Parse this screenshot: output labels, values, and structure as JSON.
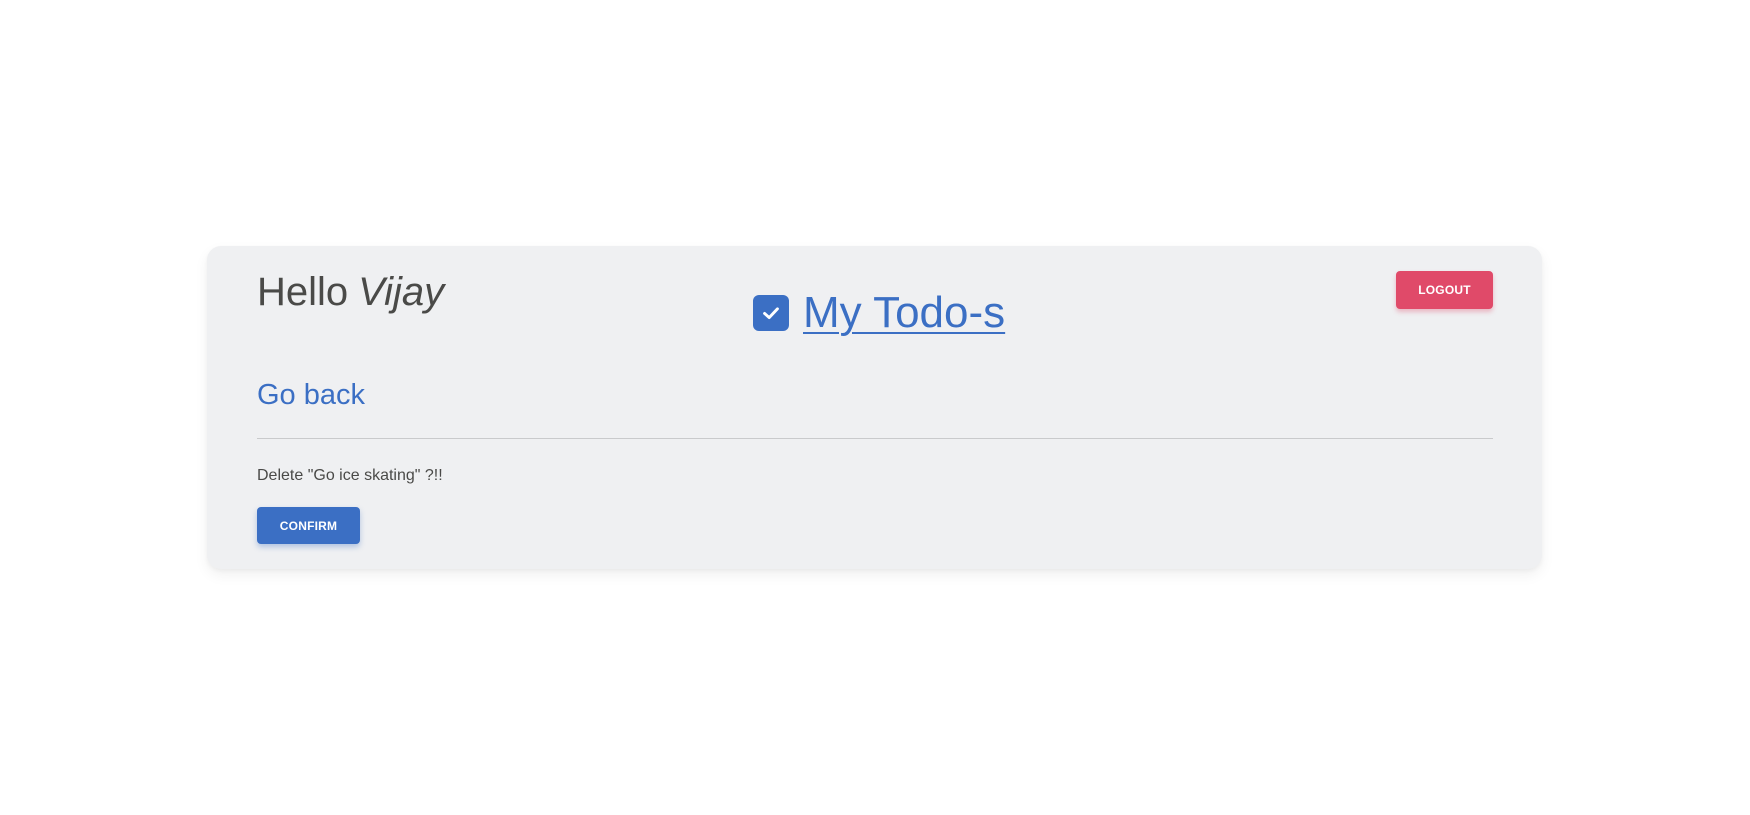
{
  "header": {
    "greeting": "Hello",
    "user_name": "Vijay",
    "brand_title": "My Todo-s",
    "brand_icon": "checkbox-checked-icon",
    "logout_label": "LOGOUT"
  },
  "nav": {
    "go_back_label": "Go back"
  },
  "confirm_dialog": {
    "message": "Delete \"Go ice skating\" ?!!",
    "confirm_label": "CONFIRM"
  },
  "colors": {
    "accent": "#3b6fc4",
    "danger": "#e04a69",
    "card_background": "#eff0f2",
    "text": "#4a4a48"
  }
}
